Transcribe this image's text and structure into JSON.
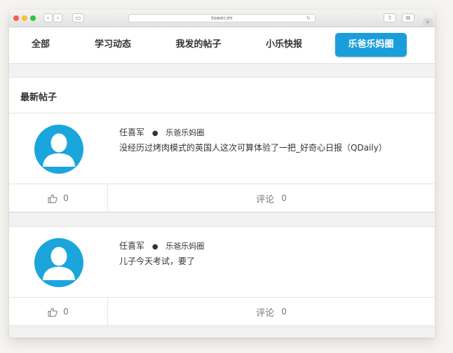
{
  "browser": {
    "url": "tower.im"
  },
  "nav": {
    "tabs": [
      {
        "label": "全部"
      },
      {
        "label": "学习动态"
      },
      {
        "label": "我发的帖子"
      },
      {
        "label": "小乐快报"
      },
      {
        "label": "乐爸乐妈圈",
        "active": true
      }
    ]
  },
  "feed": {
    "section_title": "最新帖子",
    "posts": [
      {
        "author": "任喜军",
        "circle": "乐爸乐妈圈",
        "text": "没经历过烤肉模式的英国人这次可算体验了一把_好奇心日报（QDaily）",
        "likes": "0",
        "comment_label": "评论",
        "comments": "0"
      },
      {
        "author": "任喜军",
        "circle": "乐爸乐妈圈",
        "text": "儿子今天考试，要了",
        "likes": "0",
        "comment_label": "评论",
        "comments": "0"
      }
    ]
  },
  "colors": {
    "accent": "#1a9edb",
    "avatar": "#1aa5dd"
  }
}
